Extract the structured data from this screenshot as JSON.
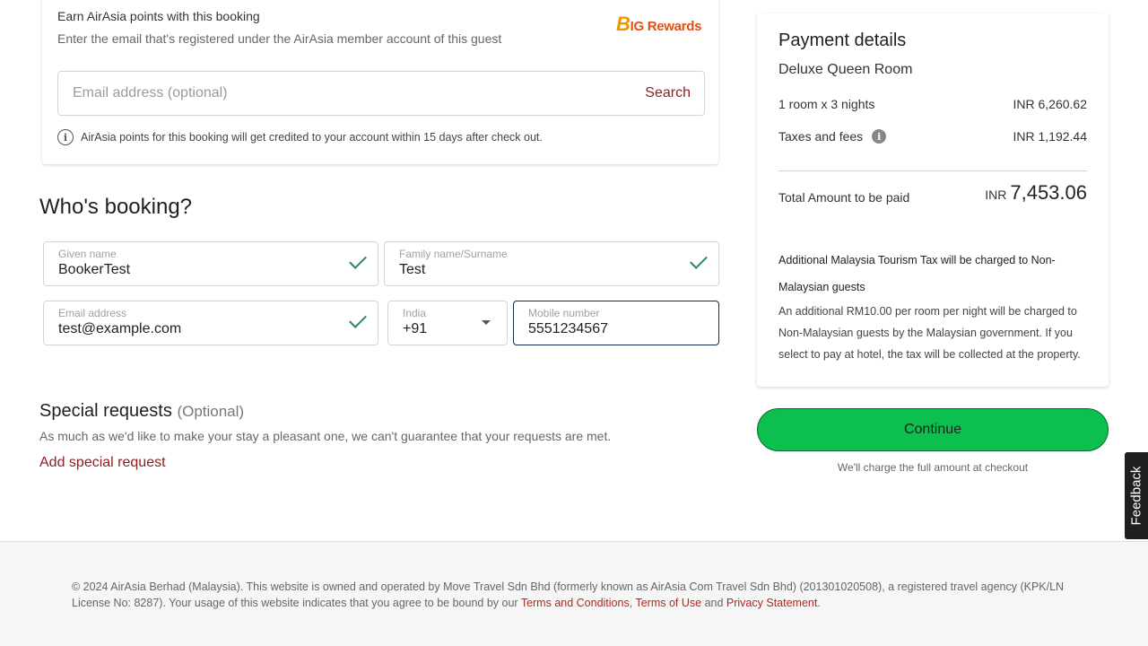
{
  "points": {
    "title": "Earn AirAsia points with this booking",
    "subtitle": "Enter the email that's registered under the AirAsia member account of this guest",
    "logo_b": "B",
    "logo_text": "IG Rewards",
    "email_placeholder": "Email address (optional)",
    "search_label": "Search",
    "note": "AirAsia points for this booking will get credited to your account within 15 days after check out."
  },
  "booking": {
    "title": "Who's booking?",
    "given_name_label": "Given name",
    "given_name_value": "BookerTest",
    "family_name_label": "Family name/Surname",
    "family_name_value": "Test",
    "email_label": "Email address",
    "email_value": "test@example.com",
    "country_label": "India",
    "country_code": "+91",
    "mobile_label": "Mobile number",
    "mobile_value": "5551234567"
  },
  "special_requests": {
    "title": "Special requests",
    "optional": "(Optional)",
    "subtitle": "As much as we'd like to make your stay a pleasant one, we can't guarantee that your requests are met.",
    "add_link": "Add special request"
  },
  "payment": {
    "title": "Payment details",
    "room_name": "Deluxe Queen Room",
    "rooms_nights_label": "1 room x 3 nights",
    "rooms_nights_amount": "INR 6,260.62",
    "taxes_label": "Taxes and fees",
    "taxes_amount": "INR 1,192.44",
    "total_label": "Total Amount to be paid",
    "total_currency": "INR",
    "total_value": "7,453.06",
    "tax_title": "Additional Malaysia Tourism Tax will be charged to Non-Malaysian guests",
    "tax_body": "An additional RM10.00 per room per night will be charged to Non-Malaysian guests by the Malaysian government. If you select to pay at hotel, the tax will be collected at the property."
  },
  "continue_label": "Continue",
  "charge_note": "We'll charge the full amount at checkout",
  "feedback_label": "Feedback",
  "footer": {
    "text_before": "© 2024 AirAsia Berhad (Malaysia). This website is owned and operated by Move Travel Sdn Bhd (formerly known as AirAsia Com Travel Sdn Bhd) (201301020508), a registered travel agency (KPK/LN License No: 8287). Your usage of this website indicates that you agree to be bound by our ",
    "terms_conditions": "Terms and Conditions",
    "sep1": ", ",
    "terms_use": "Terms of Use",
    "sep2": " and ",
    "privacy": "Privacy Statement",
    "end": "."
  },
  "colors": {
    "brand_red": "#8e1d1d",
    "continue_green": "#0cbf4f",
    "check_green": "#1e8e5a"
  }
}
